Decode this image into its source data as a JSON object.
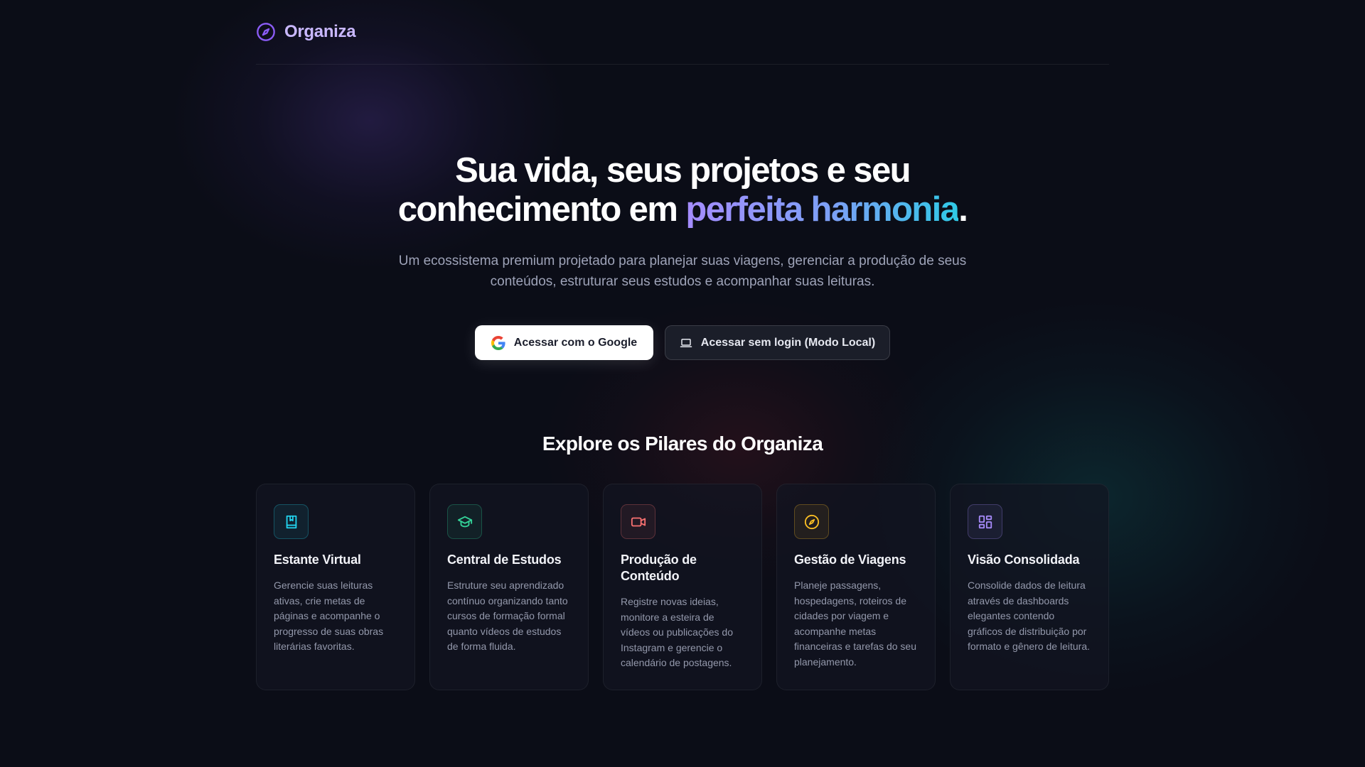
{
  "brand": {
    "name": "Organiza",
    "icon": "compass-icon",
    "color": "#8b5cf6"
  },
  "hero": {
    "title_line1": "Sua vida, seus projetos e seu",
    "title_line2_start": "conhecimento em ",
    "title_accent": "perfeita harmonia",
    "title_end": ".",
    "subtitle": "Um ecossistema premium projetado para planejar suas viagens, gerenciar a produção de seus conteúdos, estruturar seus estudos e acompanhar suas leituras."
  },
  "actions": {
    "google_label": "Acessar com o Google",
    "google_icon": "google-icon",
    "local_label": "Acessar sem login (Modo Local)",
    "local_icon": "laptop-icon"
  },
  "pillars": {
    "title": "Explore os Pilares do Organiza",
    "cards": [
      {
        "title": "Estante Virtual",
        "text": "Gerencie suas leituras ativas, crie metas de páginas e acompanhe o progresso de suas obras literárias favoritas.",
        "icon": "book-icon",
        "color": "#22d3ee"
      },
      {
        "title": "Central de Estudos",
        "text": "Estruture seu aprendizado contínuo organizando tanto cursos de formação formal quanto vídeos de estudos de forma fluida.",
        "icon": "graduation-cap-icon",
        "color": "#34d399"
      },
      {
        "title": "Produção de Conteúdo",
        "text": "Registre novas ideias, monitore a esteira de vídeos ou publicações do Instagram e gerencie o calendário de postagens.",
        "icon": "video-icon",
        "color": "#f87171"
      },
      {
        "title": "Gestão de Viagens",
        "text": "Planeje passagens, hospedagens, roteiros de cidades por viagem e acompanhe metas financeiras e tarefas do seu planejamento.",
        "icon": "compass-icon",
        "color": "#fbbf24"
      },
      {
        "title": "Visão Consolidada",
        "text": "Consolide dados de leitura através de dashboards elegantes contendo gráficos de distribuição por formato e gênero de leitura.",
        "icon": "dashboard-icon",
        "color": "#a78bfa"
      }
    ]
  }
}
